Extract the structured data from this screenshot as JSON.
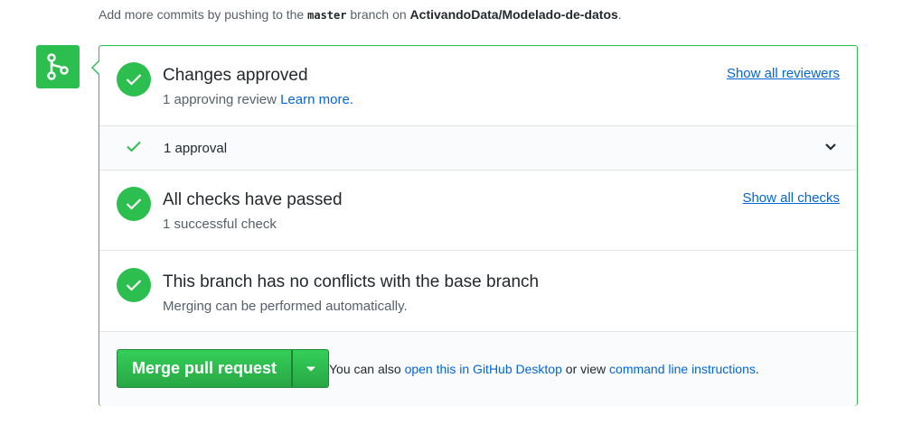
{
  "hint": {
    "prefix": "Add more commits by pushing to the",
    "branch": "master",
    "middle": "branch on",
    "repo": "ActivandoData/Modelado-de-datos",
    "suffix": "."
  },
  "approved": {
    "title": "Changes approved",
    "subtitle": "1 approving review",
    "learn_more": "Learn more.",
    "show_reviewers": "Show all reviewers"
  },
  "approval_row": {
    "label": "1 approval"
  },
  "checks": {
    "title": "All checks have passed",
    "subtitle": "1 successful check",
    "show_checks": "Show all checks"
  },
  "conflicts": {
    "title": "This branch has no conflicts with the base branch",
    "subtitle": "Merging can be performed automatically."
  },
  "merge": {
    "button_label": "Merge pull request",
    "also_prefix": "You can also",
    "desktop_link": "open this in GitHub Desktop",
    "also_middle": "or view",
    "cli_link": "command line instructions",
    "also_suffix": "."
  },
  "colors": {
    "success": "#2cbe4e",
    "link": "#0366d6"
  }
}
